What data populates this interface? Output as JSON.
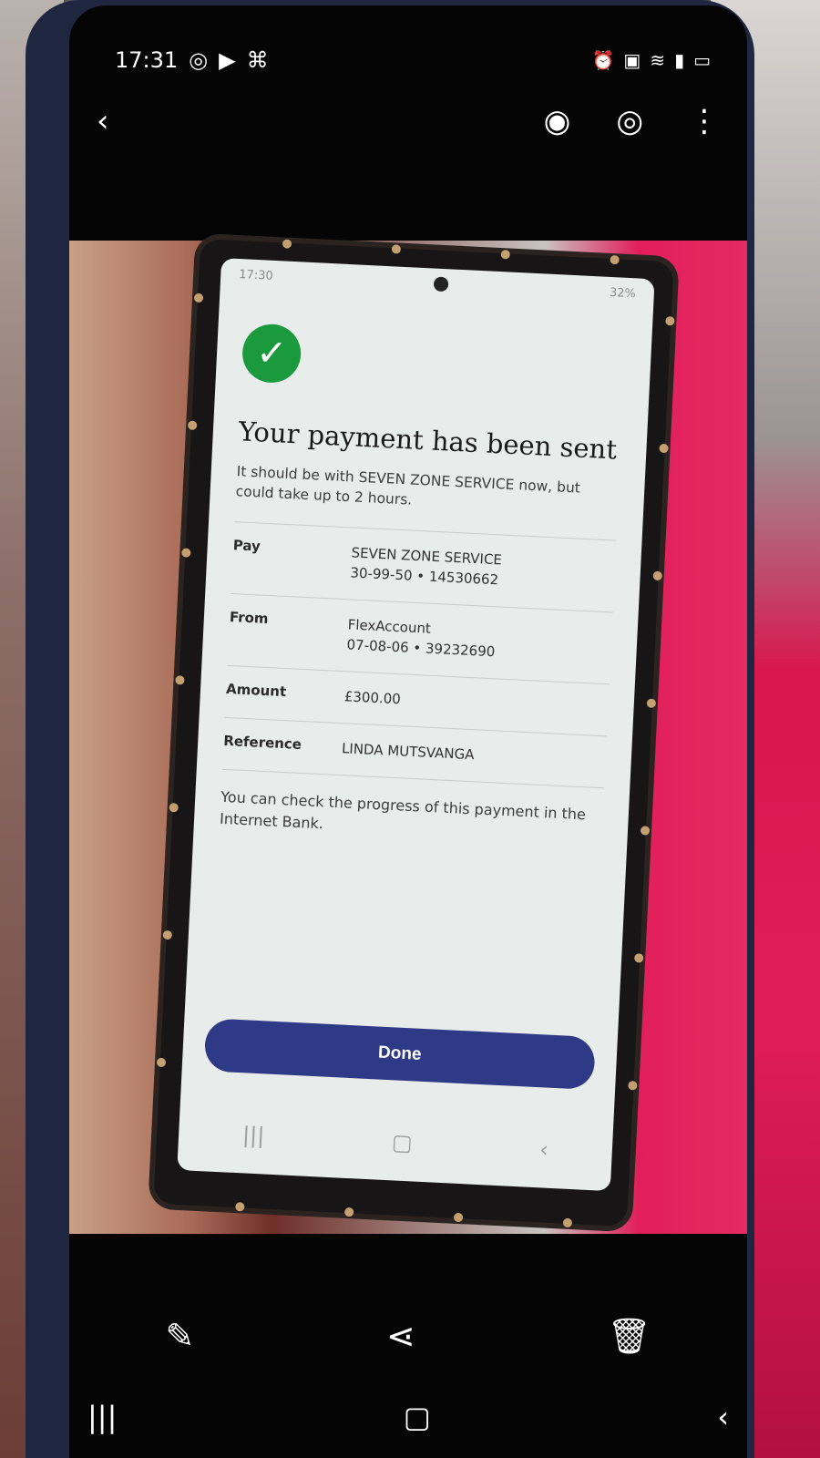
{
  "outer_status": {
    "time": "17:31",
    "left_icons": [
      "whatsapp-icon",
      "youtube-icon",
      "gallery-icon"
    ],
    "right_icons": [
      "alarm-icon",
      "lock-icon",
      "wifi-icon",
      "signal-icon",
      "battery-icon"
    ]
  },
  "outer_toolbar": {
    "back": "back-arrow-icon",
    "actions": [
      "remaster-icon",
      "eye-icon",
      "more-icon"
    ],
    "bottom_actions": [
      "edit-pencil-icon",
      "share-icon",
      "delete-trash-icon"
    ]
  },
  "inner_status": {
    "time": "17:30",
    "battery": "32%"
  },
  "payment": {
    "title": "Your payment has been sent",
    "subtitle": "It should be with SEVEN ZONE SERVICE now, but could take up to 2 hours.",
    "rows": [
      {
        "label": "Pay",
        "value": "SEVEN ZONE SERVICE",
        "detail": "30-99-50 • 14530662"
      },
      {
        "label": "From",
        "value": "FlexAccount",
        "detail": "07-08-06 • 39232690"
      },
      {
        "label": "Amount",
        "value": "£300.00",
        "detail": ""
      },
      {
        "label": "Reference",
        "value": "LINDA MUTSVANGA",
        "detail": ""
      }
    ],
    "note": "You can check the progress of this payment in the Internet Bank.",
    "done_label": "Done"
  },
  "colors": {
    "success_green": "#1a9a3c",
    "button_navy": "#2f3a86",
    "case_navy": "#1f2740"
  }
}
